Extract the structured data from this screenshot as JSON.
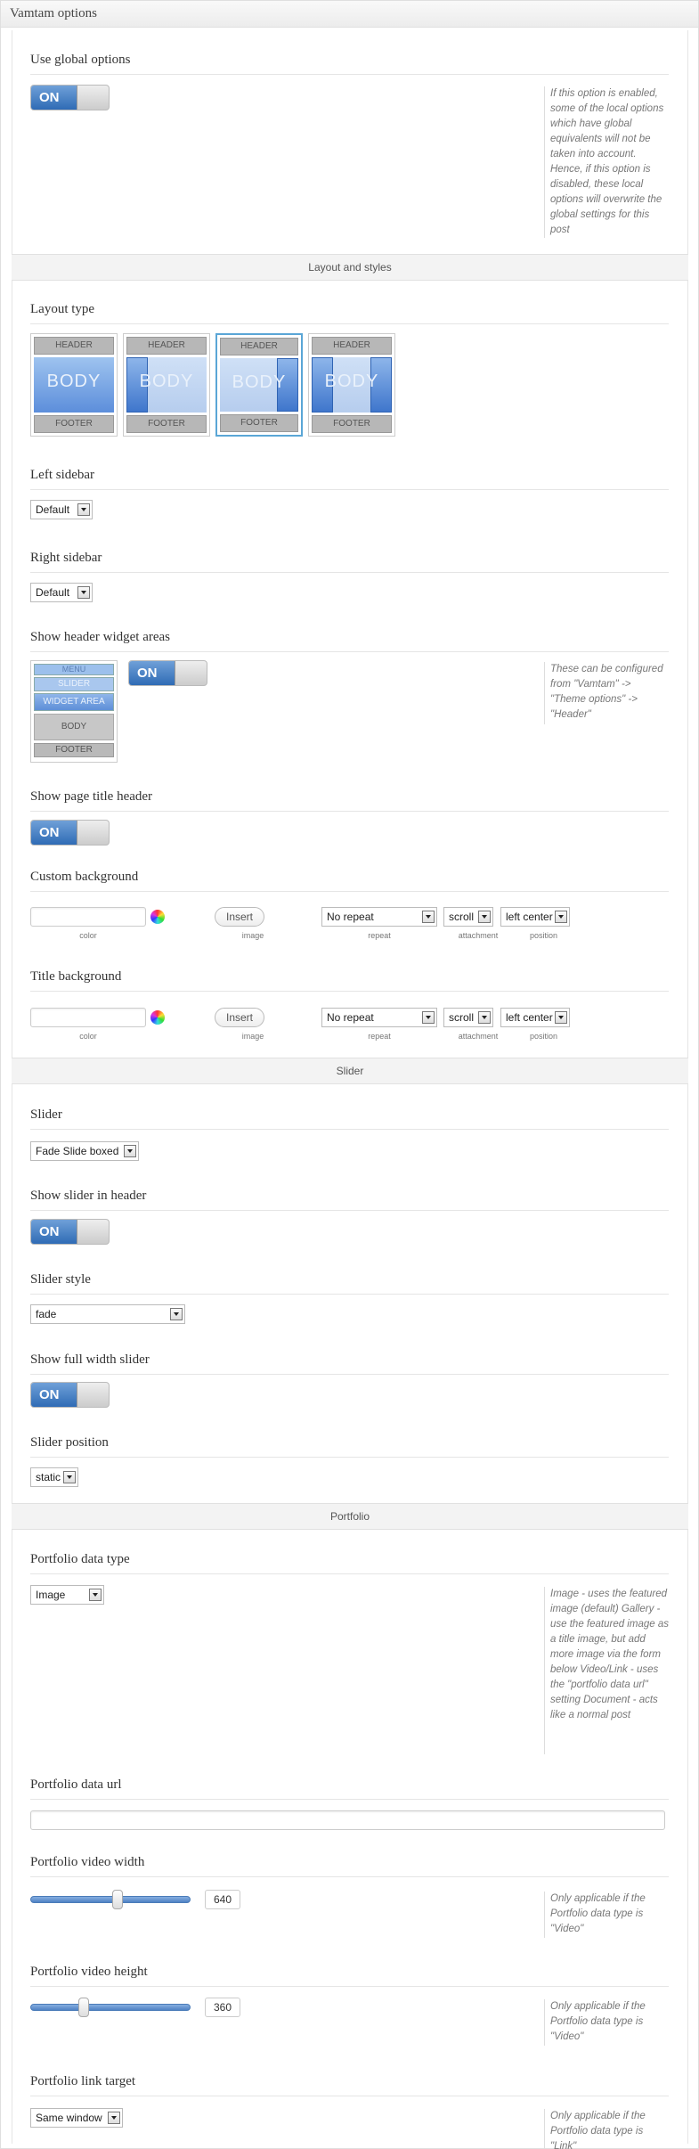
{
  "metabox": {
    "title": "Vamtam options"
  },
  "global": {
    "title": "Use global options",
    "toggle": "ON",
    "description": "If this option is enabled, some of the local options which have global equivalents will not be taken into account. Hence, if this option is disabled, these local options will overwrite the global settings for this post"
  },
  "sections": {
    "layout": "Layout and styles",
    "slider": "Slider",
    "portfolio": "Portfolio"
  },
  "layout_type": {
    "title": "Layout type",
    "header_label": "HEADER",
    "body_label": "BODY",
    "footer_label": "FOOTER",
    "options": [
      "full",
      "left-sidebar",
      "right-sidebar",
      "two-sidebars"
    ],
    "selected": "right-sidebar"
  },
  "left_sidebar": {
    "title": "Left sidebar",
    "value": "Default"
  },
  "right_sidebar": {
    "title": "Right sidebar",
    "value": "Default"
  },
  "header_widgets": {
    "title": "Show header widget areas",
    "thumb": {
      "menu": "MENU",
      "slider": "SLIDER",
      "widget": "WIDGET AREA",
      "body": "BODY",
      "footer": "FOOTER"
    },
    "toggle": "ON",
    "description": "These can be configured from \"Vamtam\" -> \"Theme options\" -> \"Header\""
  },
  "page_title_header": {
    "title": "Show page title header",
    "toggle": "ON"
  },
  "custom_background": {
    "title": "Custom background",
    "color_value": "",
    "insert_label": "Insert",
    "repeat": "No repeat",
    "attachment": "scroll",
    "position": "left center",
    "labels": {
      "color": "color",
      "image": "image",
      "repeat": "repeat",
      "attachment": "attachment",
      "position": "position"
    }
  },
  "title_background": {
    "title": "Title background",
    "color_value": "",
    "insert_label": "Insert",
    "repeat": "No repeat",
    "attachment": "scroll",
    "position": "left center",
    "labels": {
      "color": "color",
      "image": "image",
      "repeat": "repeat",
      "attachment": "attachment",
      "position": "position"
    }
  },
  "slider": {
    "title": "Slider",
    "value": "Fade Slide boxed"
  },
  "slider_in_header": {
    "title": "Show slider in header",
    "toggle": "ON"
  },
  "slider_style": {
    "title": "Slider style",
    "value": "fade"
  },
  "full_width_slider": {
    "title": "Show full width slider",
    "toggle": "ON"
  },
  "slider_position": {
    "title": "Slider position",
    "value": "static"
  },
  "portfolio_type": {
    "title": "Portfolio data type",
    "value": "Image",
    "description": "Image - uses the featured image (default) Gallery - use the featured image as a title image, but add more image via the form below Video/Link - uses the \"portfolio data url\" setting Document - acts like a normal post"
  },
  "portfolio_url": {
    "title": "Portfolio data url",
    "value": ""
  },
  "video_width": {
    "title": "Portfolio video width",
    "value": "640",
    "slider_fraction": 0.55,
    "description": "Only applicable if the Portfolio data type is \"Video\""
  },
  "video_height": {
    "title": "Portfolio video height",
    "value": "360",
    "slider_fraction": 0.32,
    "description": "Only applicable if the Portfolio data type is \"Video\""
  },
  "link_target": {
    "title": "Portfolio link target",
    "value": "Same window",
    "description": "Only applicable if the Portfolio data type is \"Link\""
  }
}
